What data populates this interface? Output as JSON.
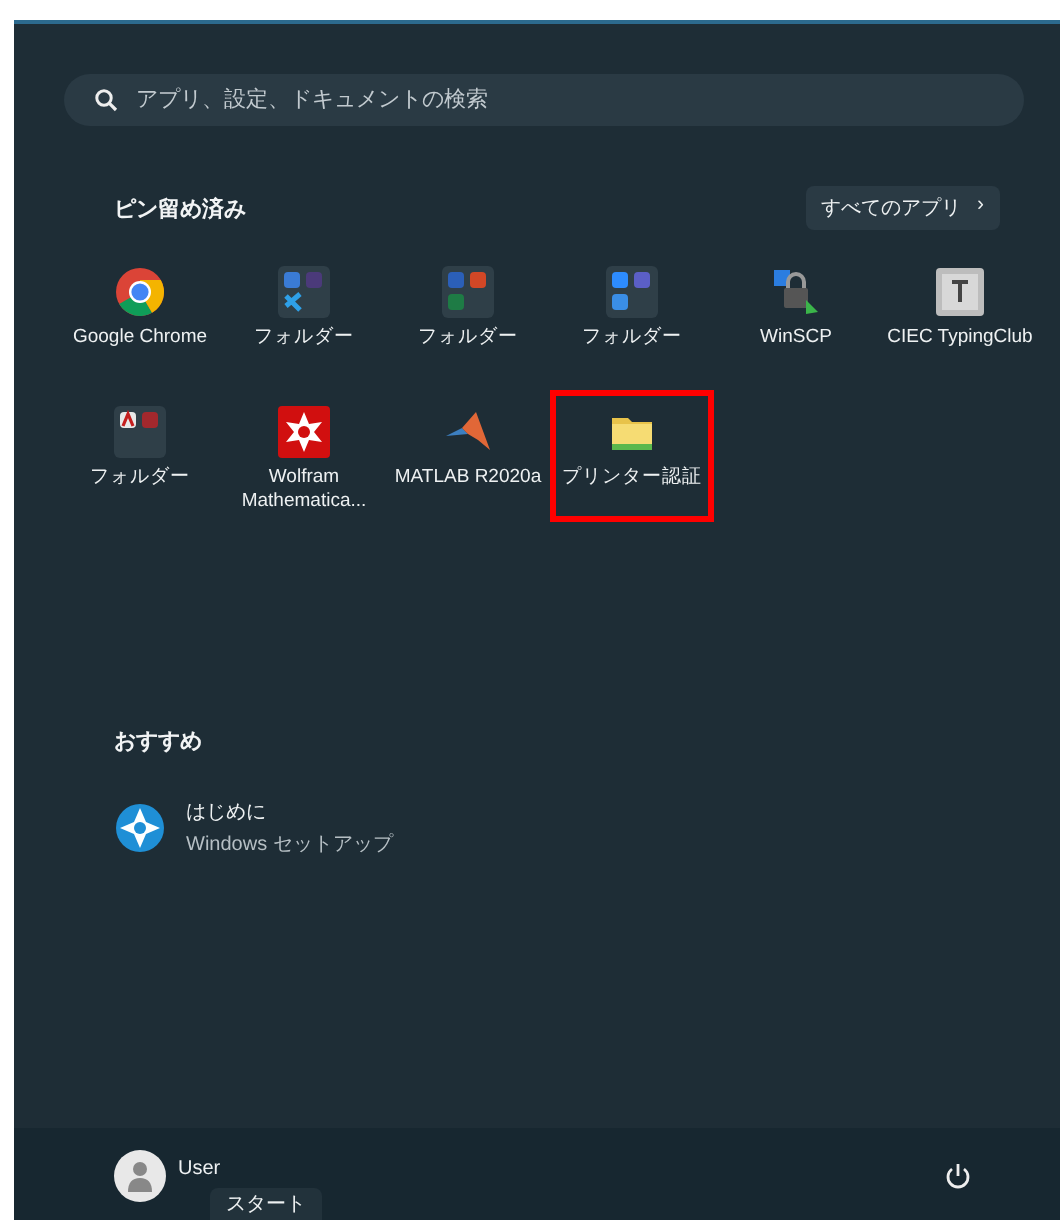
{
  "search": {
    "placeholder": "アプリ、設定、ドキュメントの検索"
  },
  "pinned": {
    "title": "ピン留め済み",
    "all_apps_button": "すべてのアプリ",
    "all_apps_chevron": "›",
    "items": [
      {
        "label": "Google Chrome",
        "kind": "chrome",
        "highlighted": false
      },
      {
        "label": "フォルダー",
        "kind": "folder-dev",
        "highlighted": false
      },
      {
        "label": "フォルダー",
        "kind": "folder-office",
        "highlighted": false
      },
      {
        "label": "フォルダー",
        "kind": "folder-meet",
        "highlighted": false
      },
      {
        "label": "WinSCP",
        "kind": "winscp",
        "highlighted": false
      },
      {
        "label": "CIEC TypingClub",
        "kind": "key",
        "highlighted": false
      },
      {
        "label": "フォルダー",
        "kind": "folder-cad",
        "highlighted": false
      },
      {
        "label": "Wolfram Mathematica...",
        "kind": "wolfram",
        "highlighted": false
      },
      {
        "label": "MATLAB R2020a",
        "kind": "matlab",
        "highlighted": false
      },
      {
        "label": "プリンター認証",
        "kind": "folder",
        "highlighted": true
      }
    ]
  },
  "recommended": {
    "title": "おすすめ",
    "items": [
      {
        "title": "はじめに",
        "subtitle": "Windows セットアップ"
      }
    ]
  },
  "footer": {
    "user": "User",
    "tooltip": "スタート"
  }
}
